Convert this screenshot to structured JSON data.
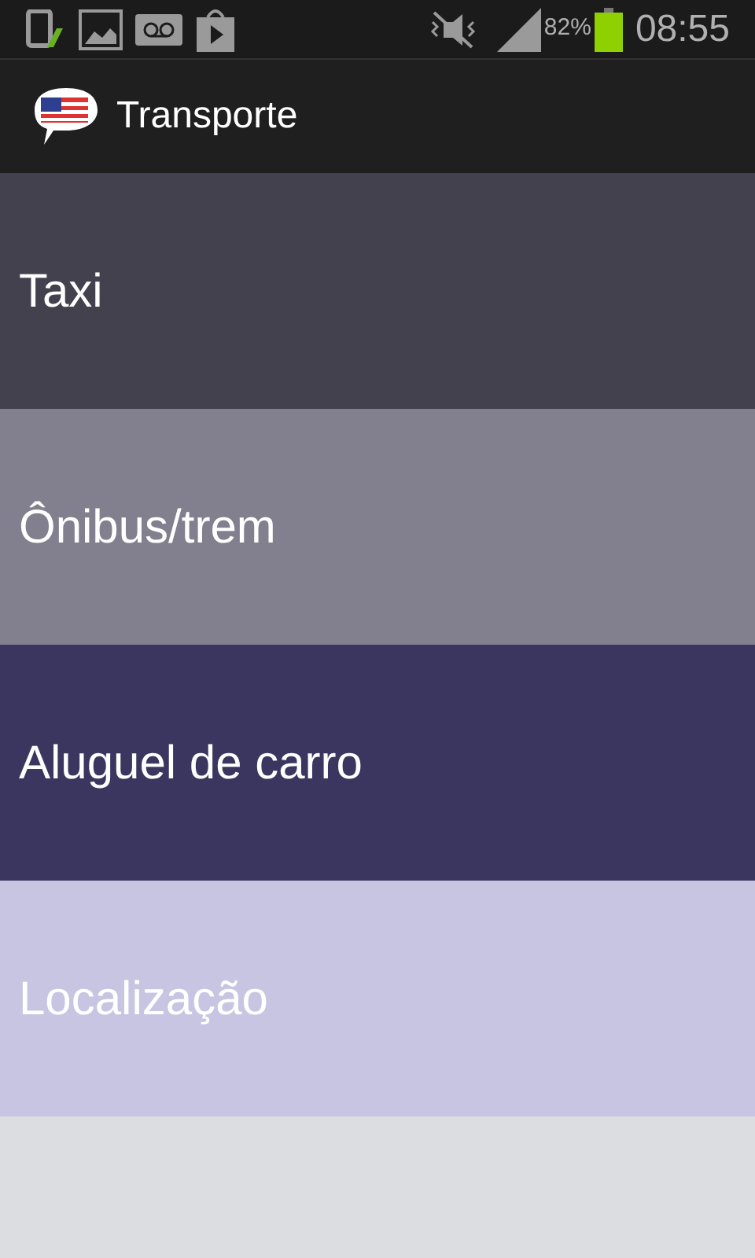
{
  "status_bar": {
    "battery_text": "82%",
    "time": "08:55"
  },
  "app_bar": {
    "title": "Transporte"
  },
  "items": [
    {
      "label": "Taxi",
      "color": "#42414d"
    },
    {
      "label": "Ônibus/trem",
      "color": "#82808f"
    },
    {
      "label": "Aluguel de carro",
      "color": "#3a3660"
    },
    {
      "label": "Localização",
      "color": "#c8c5e3"
    }
  ]
}
